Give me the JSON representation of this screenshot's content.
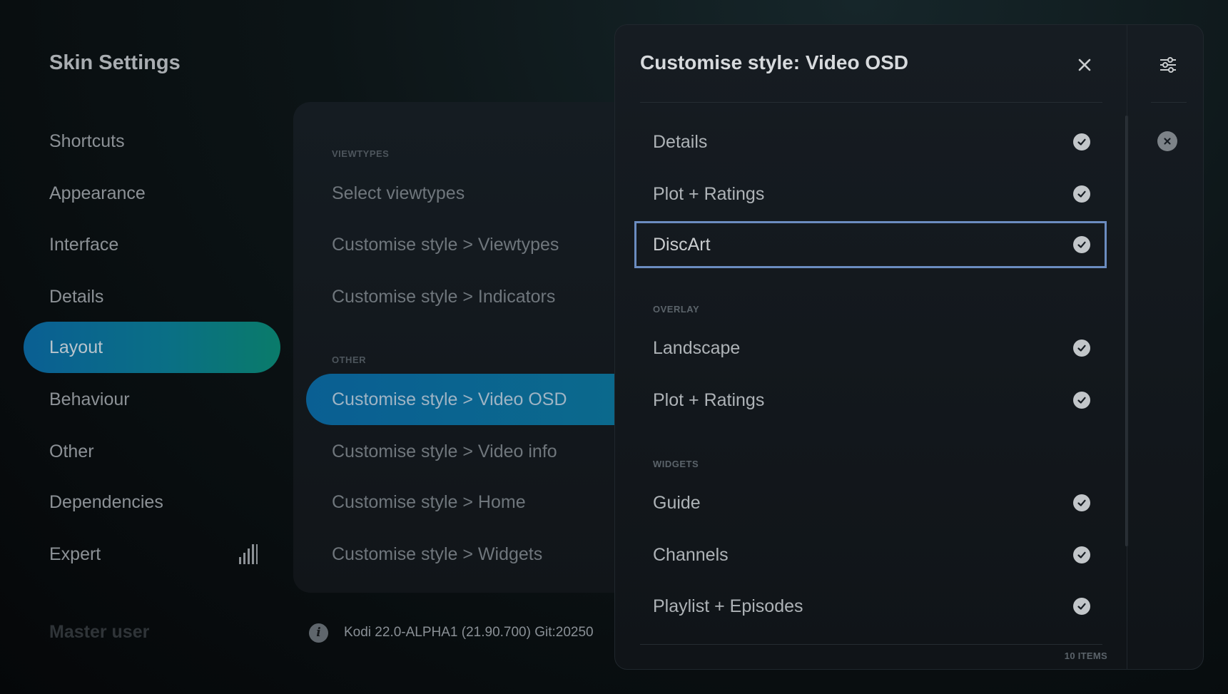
{
  "app": {
    "title": "Skin Settings"
  },
  "sidebar": {
    "items": [
      {
        "label": "Shortcuts"
      },
      {
        "label": "Appearance"
      },
      {
        "label": "Interface"
      },
      {
        "label": "Details"
      },
      {
        "label": "Layout",
        "active": true
      },
      {
        "label": "Behaviour"
      },
      {
        "label": "Other"
      },
      {
        "label": "Dependencies"
      },
      {
        "label": "Expert",
        "icon": "signal-bars-icon"
      }
    ],
    "footer_label": "Master user"
  },
  "middle": {
    "sections": {
      "viewtypes": "VIEWTYPES",
      "other": "OTHER"
    },
    "items": [
      {
        "label": "Select viewtypes"
      },
      {
        "label": "Customise style > Viewtypes"
      },
      {
        "label": "Customise style > Indicators"
      },
      {
        "label": "Customise style > Video OSD",
        "active": true
      },
      {
        "label": "Customise style > Video info"
      },
      {
        "label": "Customise style > Home"
      },
      {
        "label": "Customise style > Widgets"
      }
    ]
  },
  "footer": {
    "info_icon": "info-icon",
    "version": "Kodi 22.0-ALPHA1 (21.90.700) Git:20250"
  },
  "dialog": {
    "title": "Customise style: Video OSD",
    "close_icon": "close-icon",
    "settings_icon": "sliders-icon",
    "remove_icon": "remove-circle-icon",
    "sections": {
      "overlay": "OVERLAY",
      "widgets": "WIDGETS"
    },
    "options": [
      {
        "label": "Details",
        "checked": true
      },
      {
        "label": "Plot + Ratings",
        "checked": true
      },
      {
        "label": "DiscArt",
        "checked": true,
        "focused": true
      },
      {
        "label": "Landscape",
        "checked": true
      },
      {
        "label": "Plot + Ratings",
        "checked": true
      },
      {
        "label": "Guide",
        "checked": true
      },
      {
        "label": "Channels",
        "checked": true
      },
      {
        "label": "Playlist + Episodes",
        "checked": true
      }
    ],
    "items_count": "10 ITEMS"
  },
  "colors": {
    "accent_start": "#0a5f93",
    "accent_end": "#0a7b6a",
    "focus_border": "#6b8cc0"
  }
}
